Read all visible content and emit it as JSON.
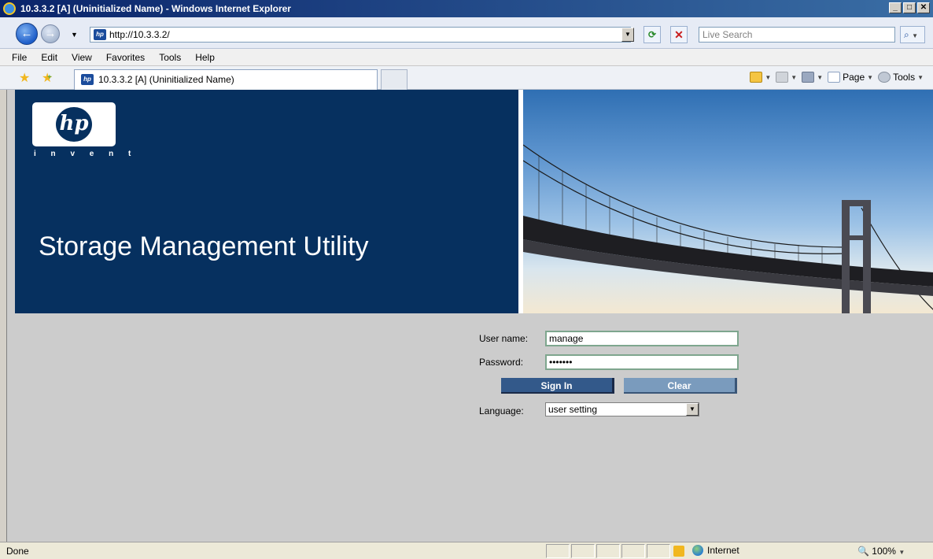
{
  "window": {
    "title": "10.3.3.2 [A] (Uninitialized Name) - Windows Internet Explorer",
    "controls": [
      "_",
      "□",
      "✕"
    ]
  },
  "address_bar": {
    "url": "http://10.3.3.2/",
    "search_placeholder": "Live Search"
  },
  "menu": [
    "File",
    "Edit",
    "View",
    "Favorites",
    "Tools",
    "Help"
  ],
  "tab": {
    "label": "10.3.3.2 [A] (Uninitialized Name)"
  },
  "command_bar": {
    "page_label": "Page",
    "tools_label": "Tools"
  },
  "banner": {
    "logo_text": "hp",
    "tagline": "i n v e n t",
    "title": "Storage Management Utility"
  },
  "login": {
    "username_label": "User name:",
    "username_value": "manage",
    "password_label": "Password:",
    "password_value": "•••••••",
    "signin_label": "Sign In",
    "clear_label": "Clear",
    "language_label": "Language:",
    "language_value": "user setting"
  },
  "status_bar": {
    "status": "Done",
    "zone": "Internet",
    "zoom": "100%"
  },
  "colors": {
    "banner_bg": "#06305f",
    "signin_bg": "#33598a",
    "clear_bg": "#7a9bbd",
    "page_bg": "#cccccc"
  }
}
